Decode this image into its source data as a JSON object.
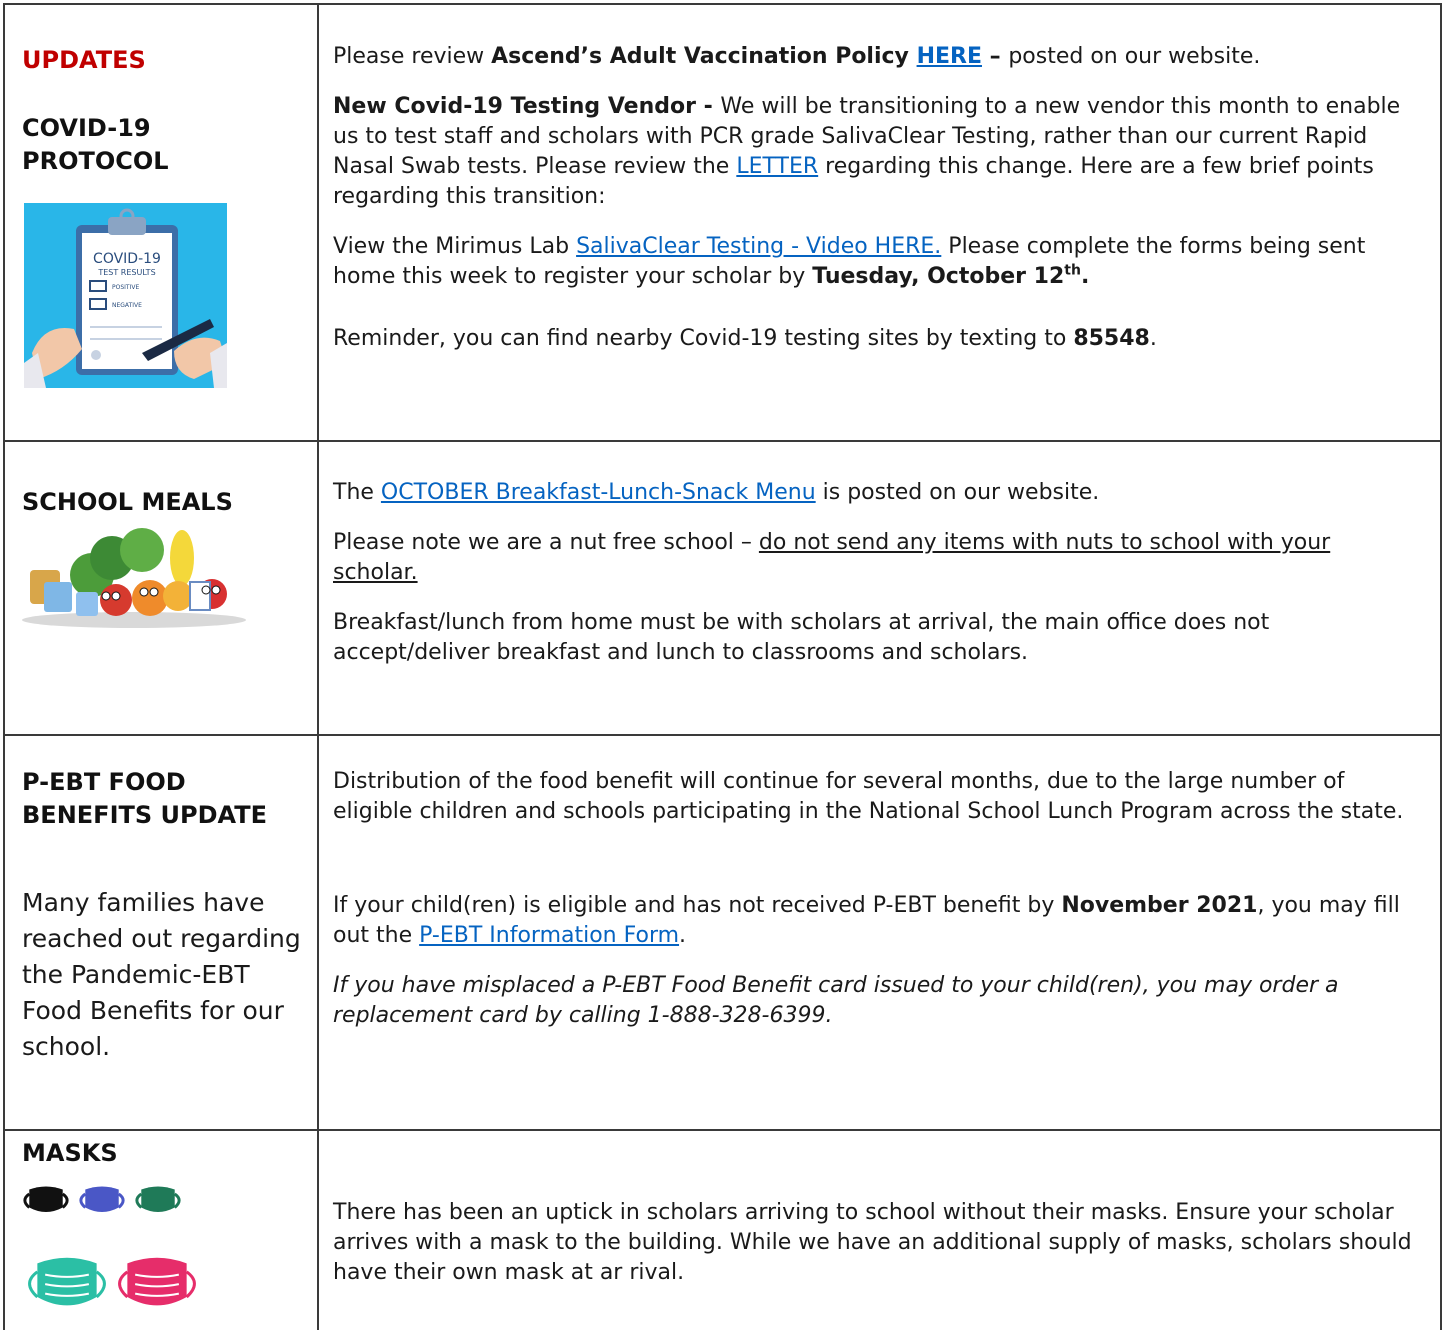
{
  "covid": {
    "updates_label": "UPDATES",
    "title": "COVID-19 PROTOCOL",
    "image": {
      "heading": "COVID-19",
      "subheading": "TEST RESULTS",
      "opt1": "POSITIVE",
      "opt2": "NEGATIVE"
    },
    "p1_pre": "Please review ",
    "p1_bold": "Ascend’s Adult Vaccination Policy ",
    "p1_link": "HERE",
    "p1_dash": " – ",
    "p1_post": "posted on our website.",
    "p2_bold": "New Covid-19 Testing Vendor - ",
    "p2_text": "We will be transitioning to a new vendor this month to enable us to test staff and scholars with PCR grade SalivaClear Testing, rather than our current Rapid Nasal Swab tests.  Please review the ",
    "p2_link": "LETTER",
    "p2_post": " regarding this change. Here are a few brief points regarding this transition:",
    "p3_pre": "View the Mirimus Lab  ",
    "p3_link": "SalivaClear Testing - Video HERE.",
    "p3_mid": " Please complete the forms being sent home this week to register your scholar by ",
    "p3_bold": "Tuesday, October 12",
    "p3_sup": "th",
    "p3_end": ".",
    "p4_pre": "Reminder, you can find nearby Covid-19 testing sites by texting to ",
    "p4_bold": "85548",
    "p4_end": "."
  },
  "meals": {
    "title": "SCHOOL MEALS",
    "p1_pre": "The ",
    "p1_link": "OCTOBER Breakfast-Lunch-Snack Menu",
    "p1_post": " is posted on our website.",
    "p2_pre": "Please note we are a nut free school – ",
    "p2_u": "do not send any items with nuts to school with your scholar.",
    "p3": "Breakfast/lunch from home must be with scholars at arrival, the main office does not accept/deliver breakfast and lunch to classrooms and scholars."
  },
  "pebt": {
    "title": "P-EBT FOOD BENEFITS UPDATE",
    "left_text": "Many families have reached out regarding the Pandemic-EBT Food Benefits for our school.",
    "p1": "Distribution of the food benefit will continue for several months, due to the large number of eligible children and schools participating in the National School Lunch Program across the state.",
    "p2_pre": "If your child(ren) is eligible and has not received P-EBT benefit by ",
    "p2_bold": "November 2021",
    "p2_mid": ", you may fill out the ",
    "p2_link": "P-EBT Information Form",
    "p2_end": ".",
    "p3": "If you have misplaced a P-EBT Food Benefit card issued to your child(ren), you may order a replacement card by calling 1-888-328-6399."
  },
  "masks": {
    "title": "MASKS",
    "colors": [
      "#111111",
      "#4a57c6",
      "#1f7a58",
      "#2bbfa5",
      "#e62d6a"
    ],
    "p1": "There has been an uptick in scholars arriving to school without their masks.  Ensure your scholar arrives with a mask to the building.  While we have an additional supply of masks, scholars should have their own mask at ar rival."
  }
}
